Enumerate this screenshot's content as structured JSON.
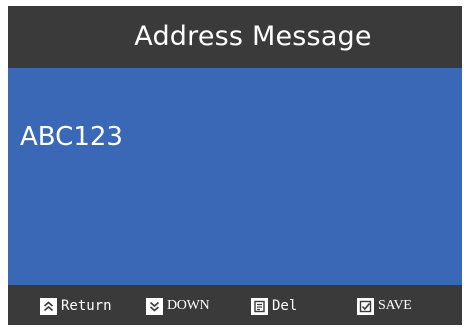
{
  "header": {
    "title": "Address Message"
  },
  "main": {
    "address_value": "ABC123"
  },
  "footer": {
    "keys": [
      {
        "label": "Return",
        "icon": "double-chevron-up-icon"
      },
      {
        "label": "DOWN",
        "icon": "double-chevron-down-icon"
      },
      {
        "label": "Del",
        "icon": "document-icon"
      },
      {
        "label": "SAVE",
        "icon": "checkbox-icon"
      }
    ]
  },
  "colors": {
    "bar_background": "#3a3a3a",
    "content_background": "#3b68b6",
    "text": "#ffffff"
  }
}
